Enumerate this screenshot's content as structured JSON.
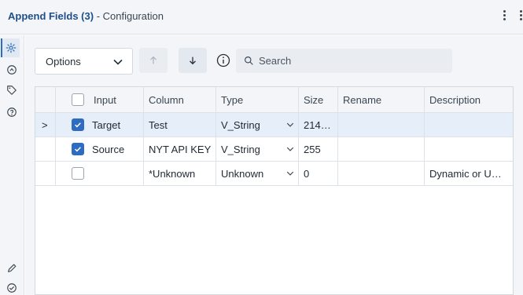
{
  "title": {
    "main": "Append Fields (3)",
    "sub": "- Configuration"
  },
  "toolbar": {
    "options_label": "Options",
    "search_placeholder": "Search"
  },
  "table": {
    "headers": {
      "input": "Input",
      "column": "Column",
      "type": "Type",
      "size": "Size",
      "rename": "Rename",
      "description": "Description"
    },
    "rows": [
      {
        "expanded_marker": ">",
        "checked": true,
        "input": "Target",
        "column": "Test",
        "type": "V_String",
        "size": "214…",
        "rename": "",
        "description": ""
      },
      {
        "expanded_marker": "",
        "checked": true,
        "input": "Source",
        "column": "NYT API KEY",
        "type": "V_String",
        "size": "255",
        "rename": "",
        "description": ""
      },
      {
        "expanded_marker": "",
        "checked": false,
        "input": "",
        "column": "*Unknown",
        "type": "Unknown",
        "size": "0",
        "rename": "",
        "description": "Dynamic or U…"
      }
    ]
  },
  "colors": {
    "accent": "#2d6cc0",
    "title_main": "#1e4f8a",
    "selected_row": "#e6eef9",
    "panel_bg": "#f3f5f8"
  },
  "icons": {
    "rail": [
      "gear-icon",
      "output-icon",
      "tag-icon",
      "help-icon",
      "pencil-icon",
      "check-circle-icon"
    ],
    "toolbar": [
      "chevron-down-icon",
      "arrow-up-icon",
      "arrow-down-icon",
      "info-icon",
      "search-icon"
    ]
  }
}
